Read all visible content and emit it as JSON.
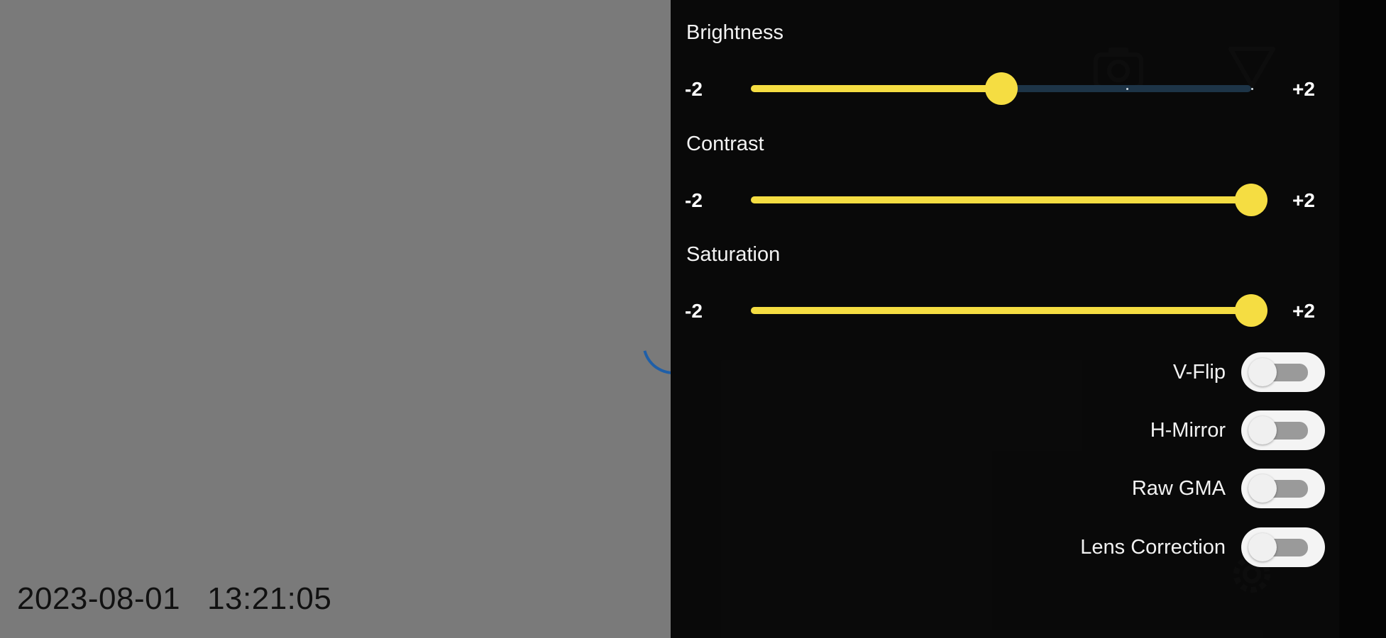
{
  "preview": {
    "date": "2023-08-01",
    "time": "13:21:05"
  },
  "icons": {
    "camera": "camera-icon",
    "filter": "filter-icon",
    "settings": "gear-icon"
  },
  "colors": {
    "accent": "#f5dd42",
    "track_inactive": "#1d3447",
    "panel_bg": "#0a0a0a",
    "preview_bg": "#7a7a7a"
  },
  "sliders": [
    {
      "label": "Brightness",
      "min_label": "-2",
      "max_label": "+2",
      "min": -2,
      "max": 2,
      "value": 0
    },
    {
      "label": "Contrast",
      "min_label": "-2",
      "max_label": "+2",
      "min": -2,
      "max": 2,
      "value": 2
    },
    {
      "label": "Saturation",
      "min_label": "-2",
      "max_label": "+2",
      "min": -2,
      "max": 2,
      "value": 2
    }
  ],
  "toggles": [
    {
      "label": "V-Flip",
      "on": false
    },
    {
      "label": "H-Mirror",
      "on": false
    },
    {
      "label": "Raw GMA",
      "on": false
    },
    {
      "label": "Lens Correction",
      "on": false
    }
  ]
}
